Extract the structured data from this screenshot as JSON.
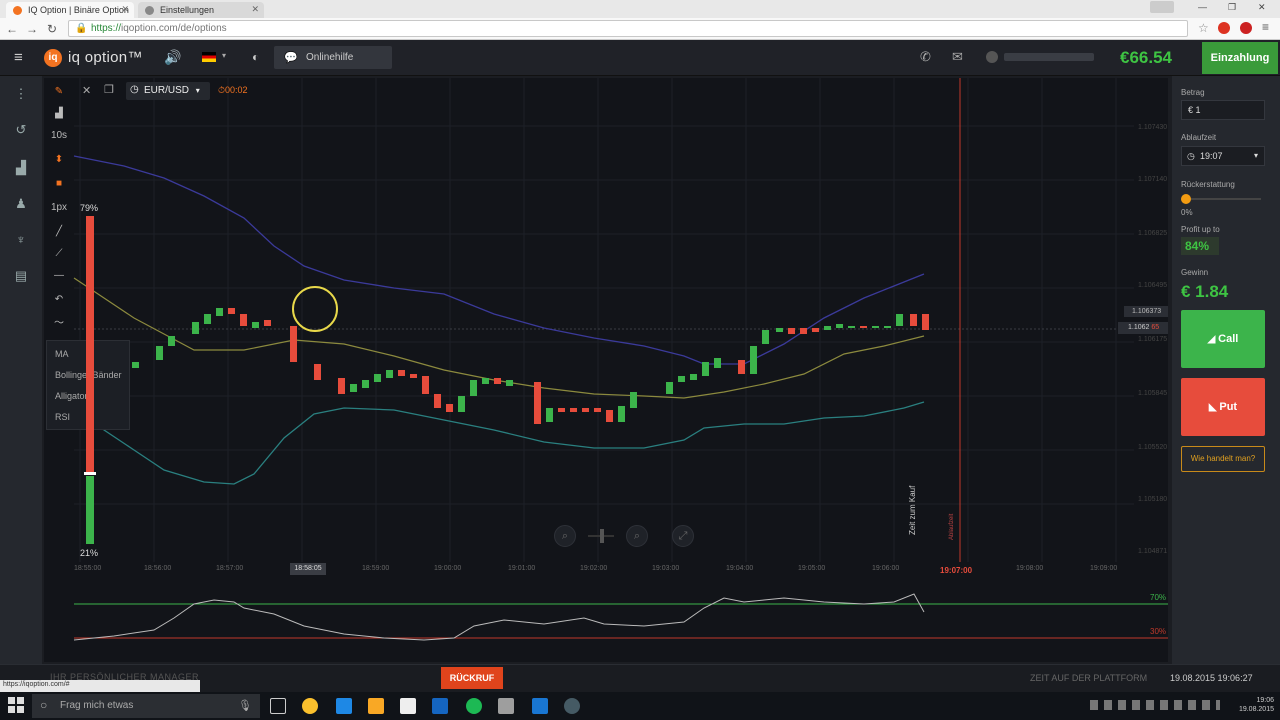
{
  "browser": {
    "tabs": [
      {
        "title": "IQ Option | Binäre Option"
      },
      {
        "title": "Einstellungen"
      }
    ],
    "url_scheme": "https://",
    "url_rest": "iqoption.com/de/options"
  },
  "header": {
    "logo_letter": "iq",
    "logo_text": "iq option™",
    "help_label": "Onlinehilfe",
    "balance": "€66.54",
    "deposit_label": "Einzahlung"
  },
  "chart": {
    "pair": "EUR/USD",
    "timer": "00:02",
    "up_percent": "79%",
    "down_percent": "21%",
    "current_price": "1.1062",
    "current_price_red": "65",
    "prev_price": "1.106373",
    "price_axis": [
      "1.107430",
      "1.107140",
      "1.106825",
      "1.106495",
      "1.106175",
      "1.105845",
      "1.105520",
      "1.105180",
      "1.104871"
    ],
    "time_axis": [
      "18:55:00",
      "18:56:00",
      "18:57:00",
      "18:59:00",
      "19:00:00",
      "19:01:00",
      "19:02:00",
      "19:03:00",
      "19:04:00",
      "19:05:00",
      "19:06:00",
      "19:08:00",
      "19:09:00"
    ],
    "time_highlight": "18:58:05",
    "expiry_time": "19:07:00",
    "purchase_label": "Zeit zum Kauf",
    "expiry_label": "Ablaufzeit",
    "rsi_high": "70%",
    "rsi_low": "30%",
    "tools": [
      "10s",
      "1px"
    ],
    "indicators": [
      "MA",
      "Bollinger Bänder",
      "Alligator",
      "RSI"
    ]
  },
  "panel": {
    "amount_label": "Betrag",
    "amount_value": "€ 1",
    "expiry_label": "Ablaufzeit",
    "expiry_value": "19:07",
    "refund_label": "Rückerstattung",
    "refund_value": "0%",
    "profit_label": "Profit up to",
    "profit_value": "84%",
    "gain_label": "Gewinn",
    "gain_value": "€ 1.84",
    "call_label": "Call",
    "put_label": "Put",
    "how_label": "Wie handelt man?"
  },
  "bottom": {
    "manager_label": "IHR PERSÖNLICHER MANAGER",
    "callback_label": "RÜCKRUF",
    "platform_label": "ZEIT AUF DER PLATTFORM",
    "platform_value": "19.08.2015 19:06:27",
    "status_url": "https://iqoption.com/#"
  },
  "taskbar": {
    "search_placeholder": "Frag mich etwas",
    "time": "19:06",
    "date": "19.08.2015"
  }
}
